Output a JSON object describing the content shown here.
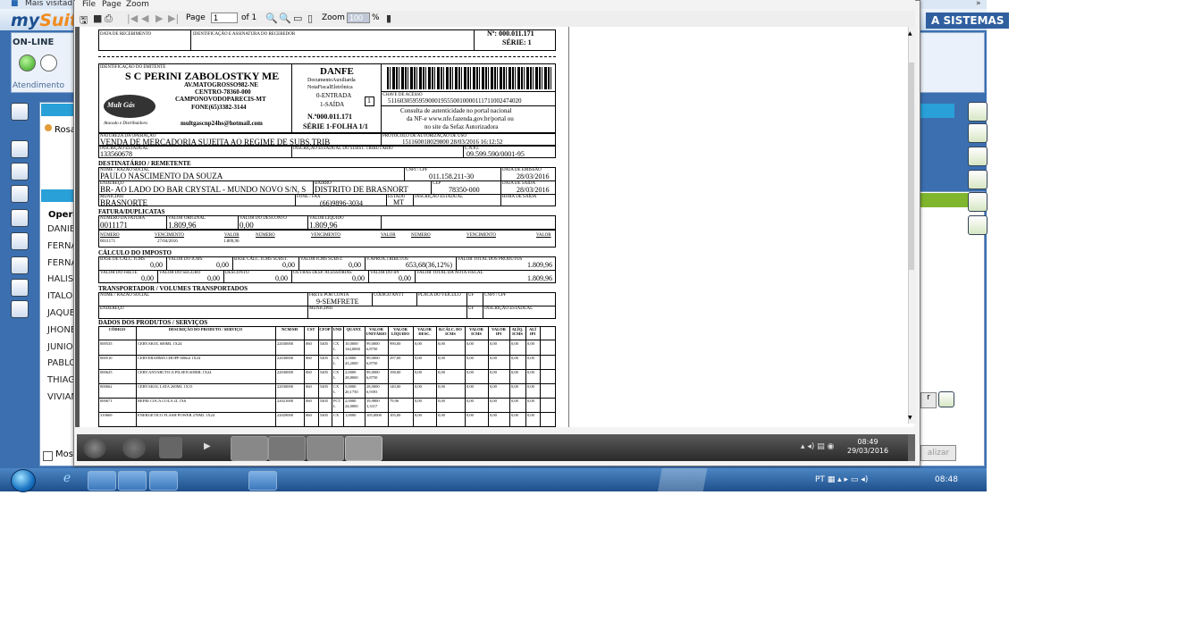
{
  "topbar": {
    "text": "Mais visitad"
  },
  "background_app": {
    "logo_prefix": "my",
    "logo_suffix": "Suite",
    "header_right": "A SISTEMAS",
    "status_label": "ON-LINE",
    "attend_label": "Atendimento",
    "contact_name": "Rosa",
    "operators_header": "Opera",
    "operators": [
      "DANIEI",
      "FERNA",
      "FERNA",
      "HALISS",
      "ITALO",
      "JAQUE",
      "JHONE",
      "JUNIOR",
      "PABLO",
      "THIAGO",
      "VIVIAN"
    ],
    "show_checkbox_label": "Mos",
    "finalize_button": "alizar",
    "right_button": "r"
  },
  "viewer": {
    "menu": [
      "File",
      "Page",
      "Zoom"
    ],
    "page_label": "Page",
    "page_value": "1",
    "page_of": "of 1",
    "zoom_label": "Zoom",
    "zoom_value": "100",
    "zoom_unit": "%"
  },
  "danfe": {
    "receipt": {
      "date_label": "DATA DE RECEBIMENTO",
      "sign_label": "IDENTIFICAÇÃO E ASSINATURA DO RECEBEDOR",
      "number": "Nº: 000.011.171",
      "series": "SÉRIE: 1"
    },
    "emitter": {
      "id_label": "IDENTIFICAÇÃO DO EMITENTE",
      "name": "S C PERINI ZABOLOSTKY ME",
      "address1": "AV.MATOGROSSO982-NE",
      "address2": "CENTRO-78360-000",
      "address3": "CAMPONOVODOPARECIS-MT",
      "phone": "FONE(65)3382-3144",
      "email": "multgascnp24hs@hotmail.com",
      "logo_text": "Mult Gás",
      "logo_sub": "Atacado e Distribuidora"
    },
    "danfe_box": {
      "title": "DANFE",
      "line1": "DocumentoAuxiliarda",
      "line2": "NotaFiscalEletrônica",
      "entrada": "0-ENTRADA",
      "saida": "1-SAÍDA",
      "type_value": "1",
      "number": "N.º000.011.171",
      "series": "SÉRIE 1-FOLHA 1/1"
    },
    "access": {
      "key_label": "CHAVE DE ACESSO",
      "key": "5116030595959000195550010000111711002474020",
      "consult1": "Consulta de autenticidade no portal nacional",
      "consult2": "da NF-e www.nfe.fazenda.gov.br/portal ou",
      "consult3": "no site da Sefaz Autorizadora"
    },
    "operation": {
      "nature_label": "NATUREZA DA OPERAÇÃO",
      "nature": "VENDA DE MERCADORIA SUJEITA AO REGIME DE SUBS.TRIB",
      "protocol_label": "PROTOCOLO DE AUTORIZAÇÃO DE USO",
      "protocol": "151160018029800   28/03/2016   16:12:52",
      "ie_label": "INSCRIÇÃO ESTADUAL",
      "ie": "133560678",
      "ie_st_label": "INSCRIÇÃO ESTADUAL DO SUBST. TRIBUTÁRIO",
      "cnpj_label": "C.N.P.J.",
      "cnpj": "09.599.590/0001-95"
    },
    "recipient": {
      "section": "DESTINATÁRIO / REMETENTE",
      "name_label": "NOME / RAZÃO SOCIAL",
      "name": "PAULO NASCIMENTO DA SOUZA",
      "cnpj_label": "CNPJ / CPF",
      "cnpj": "011.158.211-30",
      "emission_label": "DATA DE EMISSÃO",
      "emission": "28/03/2016",
      "address_label": "ENDEREÇO",
      "address": "BR- AO LADO DO BAR CRYSTAL - MUNDO NOVO S/N, S",
      "district_label": "BAIRRO",
      "district": "DISTRITO DE BRASNORT",
      "cep_label": "CEP",
      "cep": "78350-000",
      "exit_date_label": "DATA DE SAÍDA",
      "exit_date": "28/03/2016",
      "city_label": "MUNICÍPIO",
      "city": "BRASNORTE",
      "phone_label": "FONE / FAX",
      "phone": "(66)9896-3034",
      "state_label": "ESTADO",
      "state": "MT",
      "ie_label": "INSCRIÇÃO ESTADUAL",
      "exit_time_label": "HORA DE SAÍDA"
    },
    "invoice": {
      "section": "FATURA/DUPLICATAS",
      "number_label": "NÚMERO DA FATURA",
      "number": "0011171",
      "original_label": "VALOR ORIGINAL",
      "original": "1.809,96",
      "discount_label": "VALOR DO DESCONTO",
      "discount": "0,00",
      "net_label": "VALOR LÍQUIDO",
      "net": "1.809,96",
      "dup_headers": [
        "NÚMERO",
        "VENCIMENTO",
        "VALOR",
        "NÚMERO",
        "VENCIMENTO",
        "VALOR",
        "NÚMERO",
        "VENCIMENTO",
        "VALOR"
      ],
      "dup_number": "0011171",
      "dup_due": "27/04/2016",
      "dup_value": "1.809,96"
    },
    "tax": {
      "section": "CÁLCULO DO IMPOSTO",
      "row1": [
        {
          "label": "BASE DE CÁLC. ICMS",
          "value": "0,00"
        },
        {
          "label": "VALOR DO ICMS",
          "value": "0,00"
        },
        {
          "label": "BASE CÁLC. ICMS SUBST.",
          "value": "0,00"
        },
        {
          "label": "VALOR ICMS SUBST.",
          "value": "0,00"
        },
        {
          "label": "V.APROX.TRIBUTOS",
          "value": "653,68(36,12%)"
        },
        {
          "label": "VALOR TOTAL DOS PRODUTOS",
          "value": "1.809,96"
        }
      ],
      "row2": [
        {
          "label": "VALOR DO FRETE",
          "value": "0,00"
        },
        {
          "label": "VALOR DO SEGURO",
          "value": "0,00"
        },
        {
          "label": "DESCONTO",
          "value": "0,00"
        },
        {
          "label": "OUTRAS DESP. ACESSÓRIAS",
          "value": "0,00"
        },
        {
          "label": "VALOR DO IPI",
          "value": "0,00"
        },
        {
          "label": "VALOR TOTAL DA NOTA FISCAL",
          "value": "1.809,96"
        }
      ]
    },
    "transport": {
      "section": "TRANSPORTADOR / VOLUMES TRANSPORTADOS",
      "name_label": "NOME / RAZÃO SOCIAL",
      "freight_label": "FRETE POR CONTA",
      "freight": "9-SEMFRETE",
      "antt_label": "CÓDIGO ANTT",
      "plate_label": "PLACA DO VEÍCULO",
      "uf_label": "UF",
      "cnpj_label": "CNPJ / CPF",
      "address_label": "ENDEREÇO",
      "city_label": "MUNICÍPIO",
      "uf2_label": "UF",
      "ie_label": "INSCRIÇÃO ESTADUAL"
    },
    "products": {
      "section": "DADOS DOS PRODUTOS / SERVIÇOS",
      "headers": [
        "CÓDIGO",
        "DESCRIÇÃO DO PRODUTO / SERVIÇO",
        "NCM/SH",
        "CST",
        "CFOP",
        "UND",
        "QUANT.",
        "VALOR UNITÁRIO",
        "VALOR LÍQUIDO",
        "VALOR DESC.",
        "B.CÁLC. DO ICMS",
        "VALOR ICMS",
        "VALOR IPI",
        "ALÍQ. ICMS",
        "ALÍ IPI"
      ],
      "rows": [
        {
          "code": "000535",
          "desc": "CERV.SKOL 600ML 1X24",
          "ncm": "22030000",
          "cst": "060",
          "cfop": "5405",
          "und": "CX",
          "und2": "L",
          "qty": "10,0000",
          "qty2": "144,0000",
          "unit": "99,0000",
          "unit2": "6,8750",
          "net": "990,00",
          "disc": "0,00",
          "bc": "0,00",
          "icms": "0,00",
          "ipi": "0,00",
          "aicms": "0,00",
          "aipi": "0,00"
        },
        {
          "code": "000510",
          "desc": "CERVERAHMA CHOPP 600ml 1X24",
          "ncm": "22030000",
          "cst": "060",
          "cfop": "5405",
          "und": "CX",
          "und2": "L",
          "qty": "3,0000",
          "qty2": "43,2000",
          "unit": "99,0000",
          "unit2": "6,8750",
          "net": "297,00",
          "disc": "0,00",
          "bc": "0,00",
          "icms": "0,00",
          "ipi": "0,00",
          "aicms": "0,00",
          "aipi": "0,00"
        },
        {
          "code": "000625",
          "desc": "CERV.ANTARCTICA PILSEN 600ML 1X24",
          "ncm": "22030000",
          "cst": "060",
          "cfop": "5405",
          "und": "CX",
          "und2": "L",
          "qty": "2,0000",
          "qty2": "28,8000",
          "unit": "99,0000",
          "unit2": "6,8750",
          "net": "198,00",
          "disc": "0,00",
          "bc": "0,00",
          "icms": "0,00",
          "ipi": "0,00",
          "aicms": "0,00",
          "aipi": "0,00"
        },
        {
          "code": "000662",
          "desc": "CERV.SKOL LATA 269ML 1X15",
          "ncm": "22030000",
          "cst": "060",
          "cfop": "5405",
          "und": "CX",
          "und2": "L",
          "qty": "5,0000",
          "qty2": "20,1750",
          "unit": "28,0000",
          "unit2": "6,9393",
          "net": "140,00",
          "disc": "0,00",
          "bc": "0,00",
          "icms": "0,00",
          "ipi": "0,00",
          "aicms": "0,00",
          "aipi": "0,00"
        },
        {
          "code": "000671",
          "desc": "REFRI COCA COLA 2L 1X6",
          "ncm": "22021000",
          "cst": "060",
          "cfop": "5405",
          "und": "PCT",
          "und2": "L",
          "qty": "2,0000",
          "qty2": "24,0000",
          "unit": "39,9800",
          "unit2": "3,3317",
          "net": "79,96",
          "disc": "0,00",
          "bc": "0,00",
          "icms": "0,00",
          "ipi": "0,00",
          "aicms": "0,00",
          "aipi": "0,00"
        },
        {
          "code": "310669",
          "desc": "ENERGETICO FLASH POWER 270ML 1X24",
          "ncm": "22029000",
          "cst": "060",
          "cfop": "5405",
          "und": "CX",
          "und2": "",
          "qty": "1,0000",
          "qty2": "",
          "unit": "105,0000",
          "unit2": "",
          "net": "105,00",
          "disc": "0,00",
          "bc": "0,00",
          "icms": "0,00",
          "ipi": "0,00",
          "aicms": "0,00",
          "aipi": "0,00"
        }
      ]
    }
  },
  "inner_taskbar": {
    "clock_time": "08:49",
    "clock_date": "29/03/2016"
  },
  "taskbar": {
    "lang": "PT",
    "clock": "08:48"
  },
  "colors": {
    "accent": "#2aa0d8",
    "app_bg": "#3b6fb0",
    "green": "#7fb62e"
  }
}
